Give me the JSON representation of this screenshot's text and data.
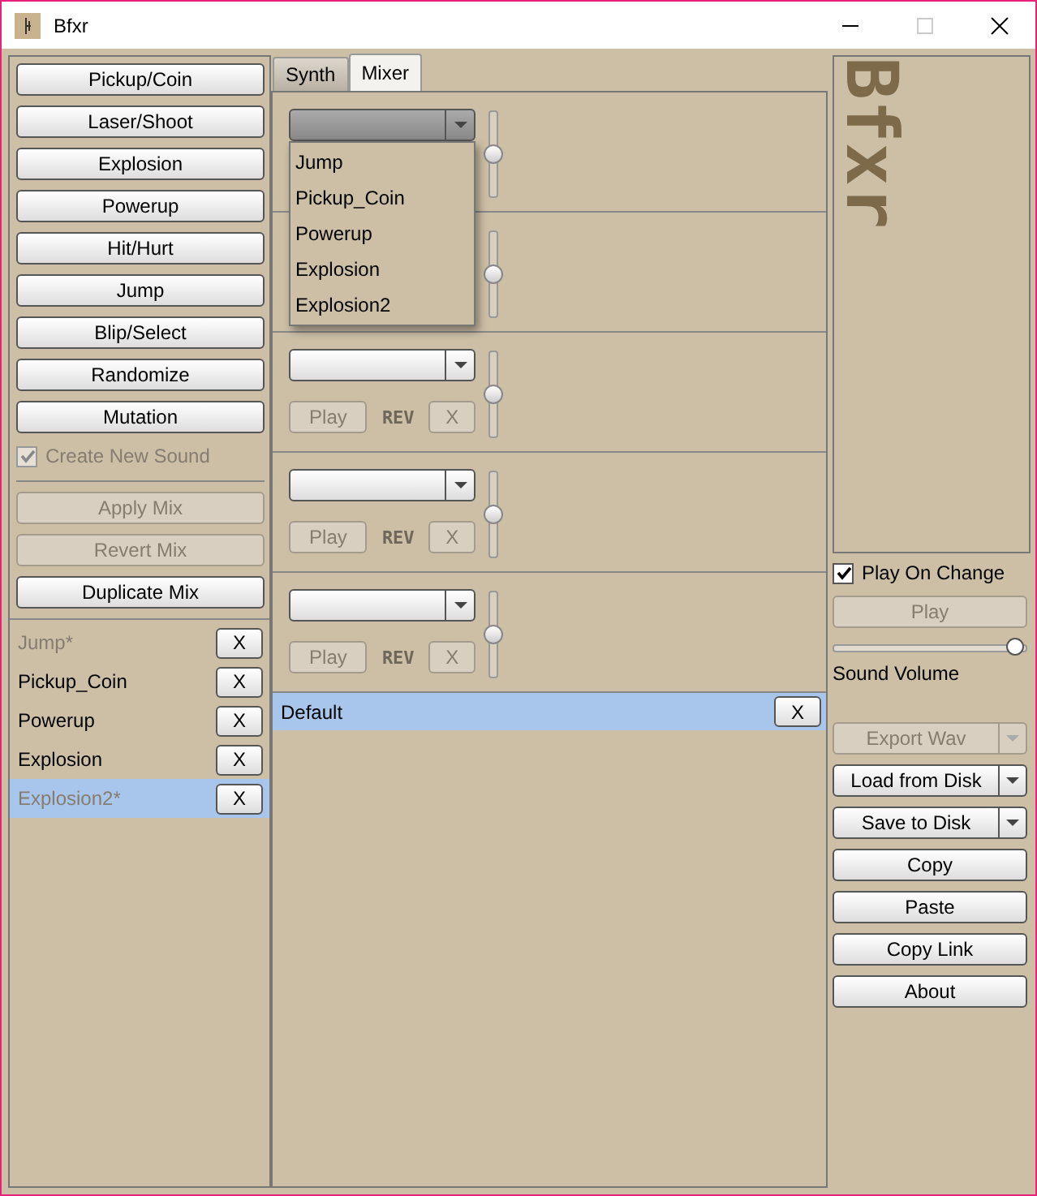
{
  "window": {
    "title": "Bfxr",
    "maximize_disabled": true
  },
  "generators": [
    "Pickup/Coin",
    "Laser/Shoot",
    "Explosion",
    "Powerup",
    "Hit/Hurt",
    "Jump",
    "Blip/Select",
    "Randomize",
    "Mutation"
  ],
  "create_new_sound": {
    "label": "Create New Sound",
    "checked": true,
    "disabled": true
  },
  "mix_buttons": [
    {
      "label": "Apply Mix",
      "disabled": true
    },
    {
      "label": "Revert Mix",
      "disabled": true
    },
    {
      "label": "Duplicate Mix",
      "disabled": false
    }
  ],
  "sounds": [
    {
      "name": "Jump*",
      "greyed": true,
      "selected": false,
      "remove": "X"
    },
    {
      "name": "Pickup_Coin",
      "greyed": false,
      "selected": false,
      "remove": "X"
    },
    {
      "name": "Powerup",
      "greyed": false,
      "selected": false,
      "remove": "X"
    },
    {
      "name": "Explosion",
      "greyed": false,
      "selected": false,
      "remove": "X"
    },
    {
      "name": "Explosion2*",
      "greyed": true,
      "selected": true,
      "remove": "X"
    }
  ],
  "tabs": [
    {
      "label": "Synth",
      "selected": false
    },
    {
      "label": "Mixer",
      "selected": true
    }
  ],
  "tracks": [
    {
      "open": true,
      "level": 0.5
    },
    {
      "level": 0.5
    },
    {
      "open": false,
      "level": 0.5,
      "play": "Play",
      "rev": "REV",
      "remove": "X"
    },
    {
      "open": false,
      "level": 0.5,
      "play": "Play",
      "rev": "REV",
      "remove": "X"
    },
    {
      "open": false,
      "level": 0.5,
      "play": "Play",
      "rev": "REV",
      "remove": "X"
    }
  ],
  "dropdown_options": [
    "Jump",
    "Pickup_Coin",
    "Powerup",
    "Explosion",
    "Explosion2"
  ],
  "mixes": [
    {
      "name": "Default",
      "selected": true,
      "remove": "X"
    }
  ],
  "logo": "Bfxr",
  "play_on_change": {
    "label": "Play On Change",
    "checked": true
  },
  "play": {
    "label": "Play",
    "disabled": true
  },
  "volume": {
    "level": 1.0,
    "label": "Sound Volume"
  },
  "file_buttons": [
    {
      "kind": "split",
      "label": "Export Wav",
      "disabled": true
    },
    {
      "kind": "split",
      "label": "Load from Disk",
      "disabled": false
    },
    {
      "kind": "split",
      "label": "Save to Disk",
      "disabled": false
    },
    {
      "kind": "plain",
      "label": "Copy",
      "disabled": false
    },
    {
      "kind": "plain",
      "label": "Paste",
      "disabled": false
    },
    {
      "kind": "plain",
      "label": "Copy Link",
      "disabled": false
    },
    {
      "kind": "plain",
      "label": "About",
      "disabled": false
    }
  ]
}
